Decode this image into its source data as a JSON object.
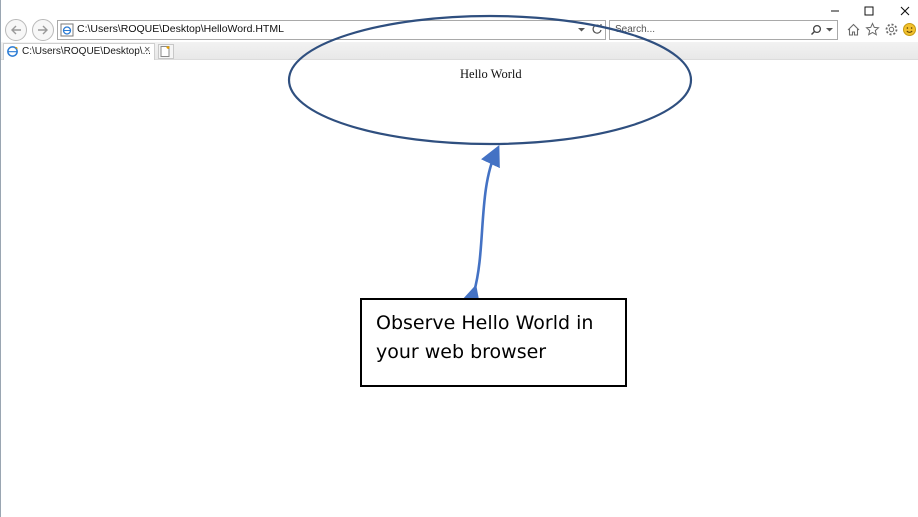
{
  "browser": {
    "address_url": "C:\\Users\\ROQUE\\Desktop\\HelloWord.HTML",
    "search_placeholder": "Search...",
    "tab_title": "C:\\Users\\ROQUE\\Desktop\\...",
    "tab_close": "×"
  },
  "page": {
    "heading": "Hello World"
  },
  "annotation": {
    "callout_text": "Observe Hello World in your web browser",
    "stroke_color": "#2f4f7f",
    "arrow_color": "#4472c4"
  },
  "icons": [
    "back-icon",
    "forward-icon",
    "ie-page-icon",
    "refresh-icon",
    "search-icon",
    "home-icon",
    "favorites-icon",
    "settings-icon",
    "smiley-icon",
    "minimize-icon",
    "maximize-icon",
    "close-icon",
    "new-tab-icon"
  ]
}
